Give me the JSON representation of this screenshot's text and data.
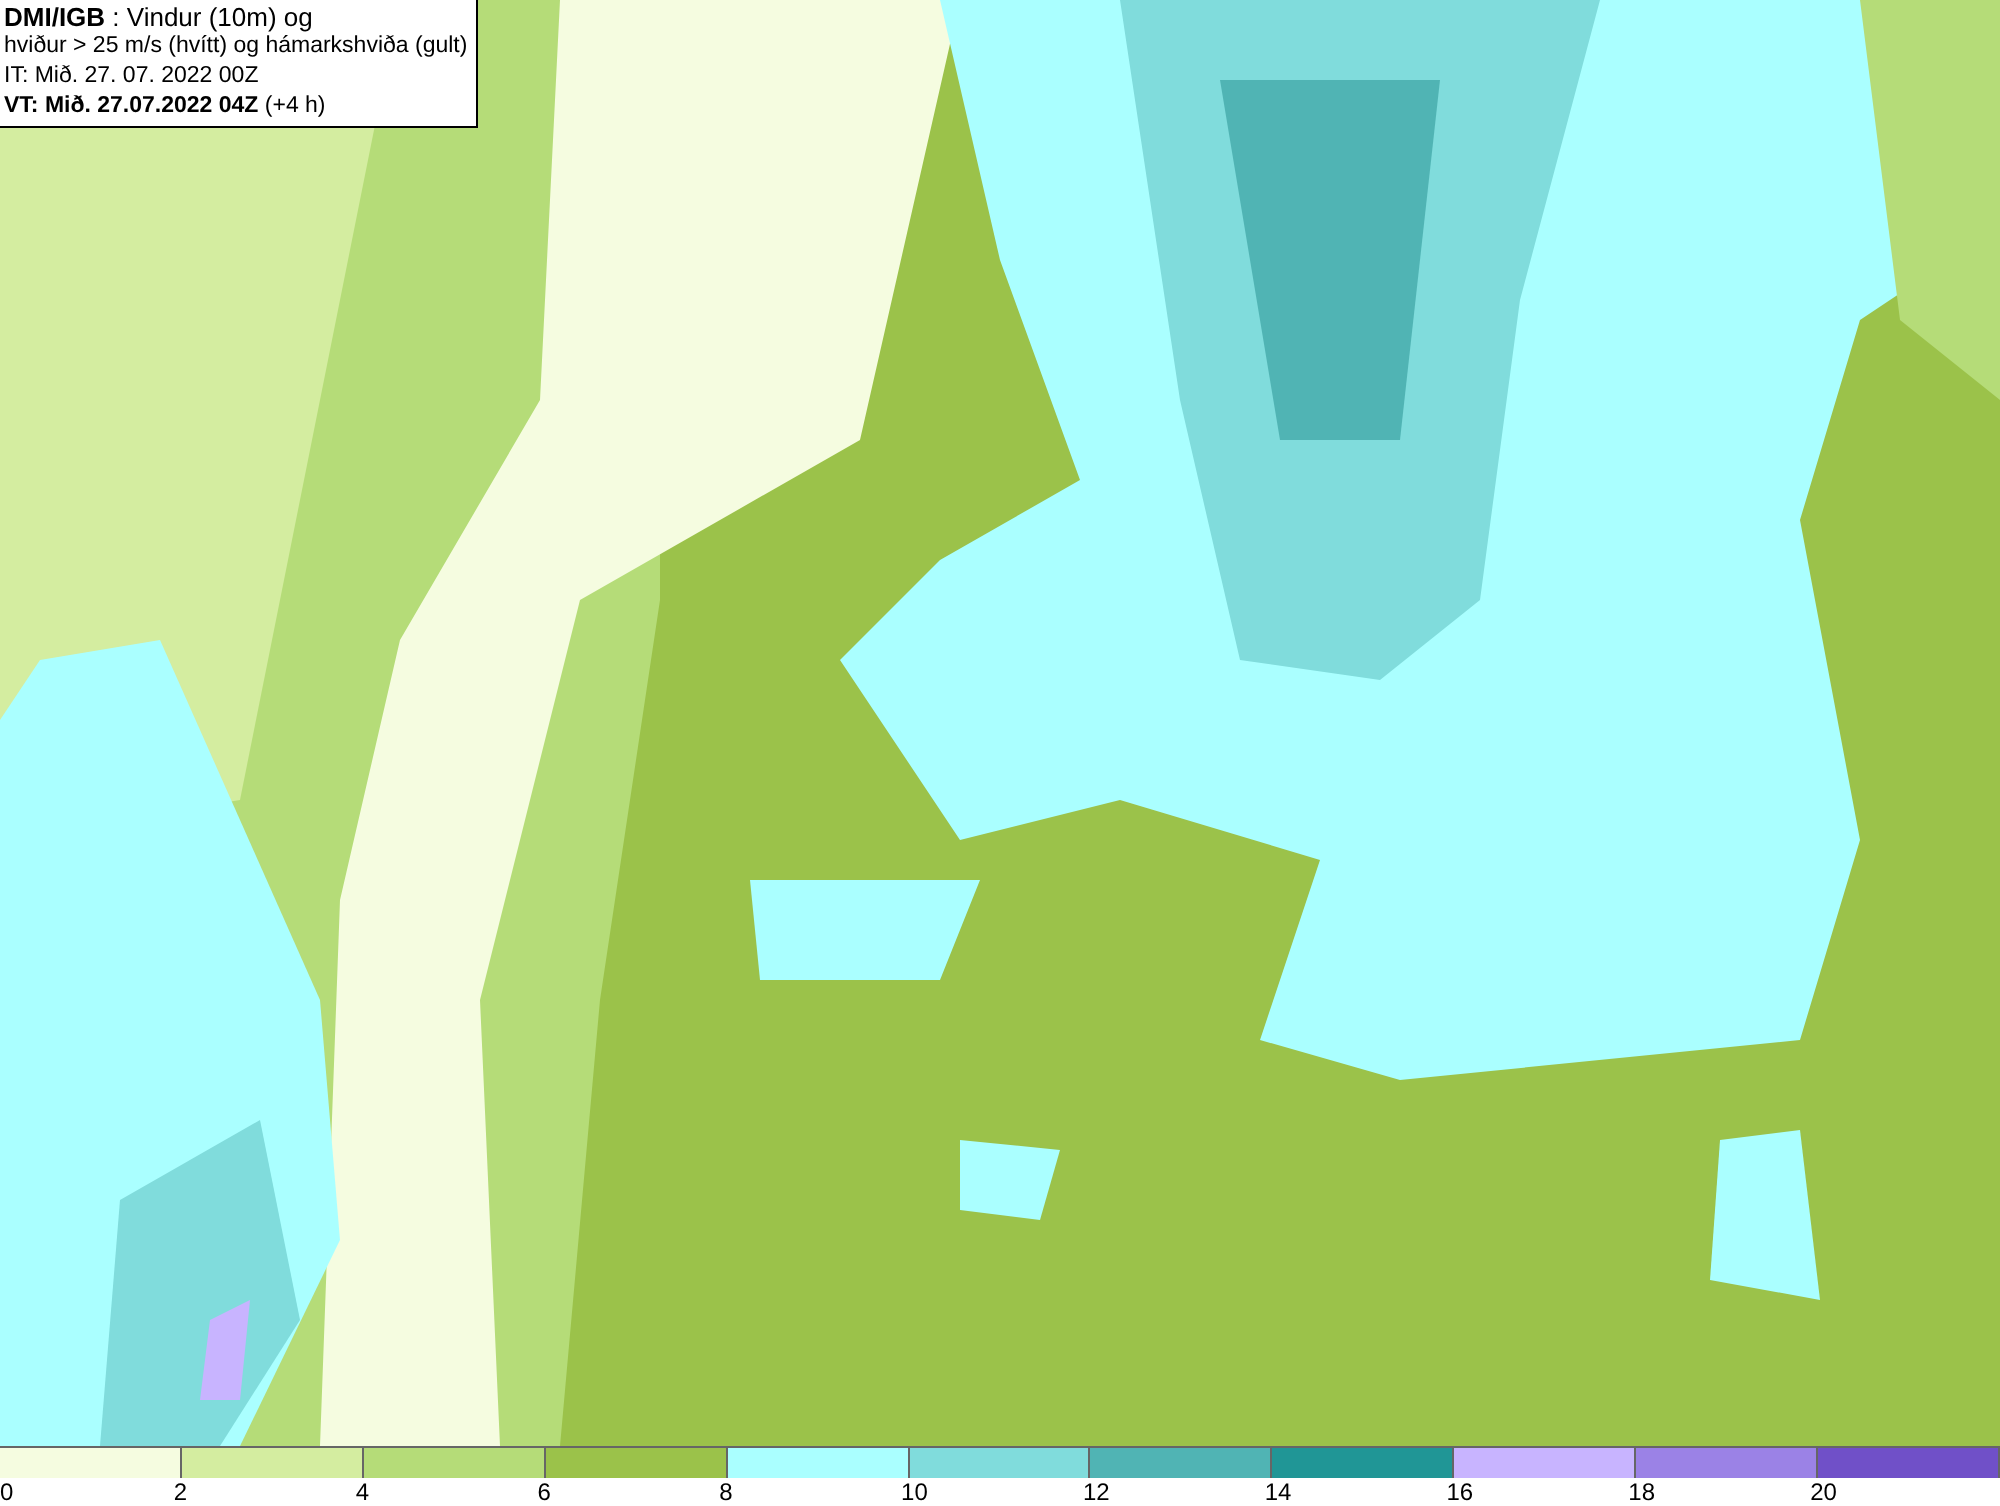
{
  "header": {
    "lines": [
      "**DMI/IGB** : Vindur (10m) og",
      "hviður > 25 m/s (hvítt) og hámarkshviða (gult)",
      "IT: Mið. 27. 07. 2022 00Z",
      "**VT: Mið. 27.07.2022 04Z** (+4 h)"
    ]
  },
  "legend": [
    {
      "label": "0",
      "color": "#f5fce0"
    },
    {
      "label": "2",
      "color": "#d4eda0"
    },
    {
      "label": "4",
      "color": "#b5dc78"
    },
    {
      "label": "6",
      "color": "#9bc24a"
    },
    {
      "label": "8",
      "color": "#aaffff"
    },
    {
      "label": "10",
      "color": "#80dcdc"
    },
    {
      "label": "12",
      "color": "#50b4b4"
    },
    {
      "label": "14",
      "color": "#209696"
    },
    {
      "label": "16",
      "color": "#c8b4ff"
    },
    {
      "label": "18",
      "color": "#9b82e6"
    },
    {
      "label": "20",
      "color": "#7050c8"
    }
  ]
}
